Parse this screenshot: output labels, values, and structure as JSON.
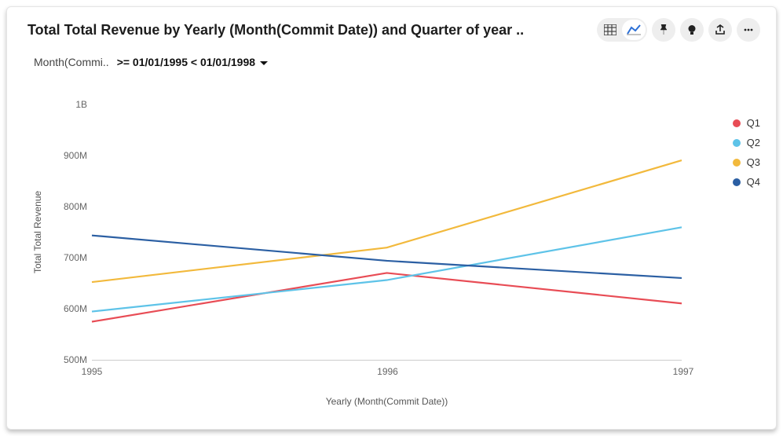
{
  "header": {
    "title": "Total Total Revenue by Yearly (Month(Commit Date)) and Quarter of year .."
  },
  "toolbar": {
    "table_icon": "table-icon",
    "chart_icon": "line-chart-icon",
    "pin_icon": "pin-icon",
    "bulb_icon": "bulb-icon",
    "share_icon": "share-icon",
    "more_icon": "more-icon"
  },
  "filter": {
    "label": "Month(Commi..",
    "value": ">= 01/01/1995 < 01/01/1998"
  },
  "axes": {
    "ylabel": "Total Total Revenue",
    "xlabel": "Yearly (Month(Commit Date))",
    "yticks": [
      "500M",
      "600M",
      "700M",
      "800M",
      "900M",
      "1B"
    ],
    "xticks": [
      "1995",
      "1996",
      "1997"
    ]
  },
  "legend": {
    "items": [
      {
        "name": "Q1",
        "color": "#e84c55"
      },
      {
        "name": "Q2",
        "color": "#5ec3e8"
      },
      {
        "name": "Q3",
        "color": "#f2b93c"
      },
      {
        "name": "Q4",
        "color": "#2b5fa3"
      }
    ]
  },
  "chart_data": {
    "type": "line",
    "title": "Total Total Revenue by Yearly (Month(Commit Date)) and Quarter of year",
    "xlabel": "Yearly (Month(Commit Date))",
    "ylabel": "Total Total Revenue",
    "ylim": [
      500000000,
      1000000000
    ],
    "categories": [
      "1995",
      "1996",
      "1997"
    ],
    "series": [
      {
        "name": "Q1",
        "color": "#e84c55",
        "values": [
          572000000,
          668000000,
          608000000
        ]
      },
      {
        "name": "Q2",
        "color": "#5ec3e8",
        "values": [
          592000000,
          654000000,
          758000000
        ]
      },
      {
        "name": "Q3",
        "color": "#f2b93c",
        "values": [
          650000000,
          718000000,
          890000000
        ]
      },
      {
        "name": "Q4",
        "color": "#2b5fa3",
        "values": [
          742000000,
          692000000,
          658000000
        ]
      }
    ]
  }
}
